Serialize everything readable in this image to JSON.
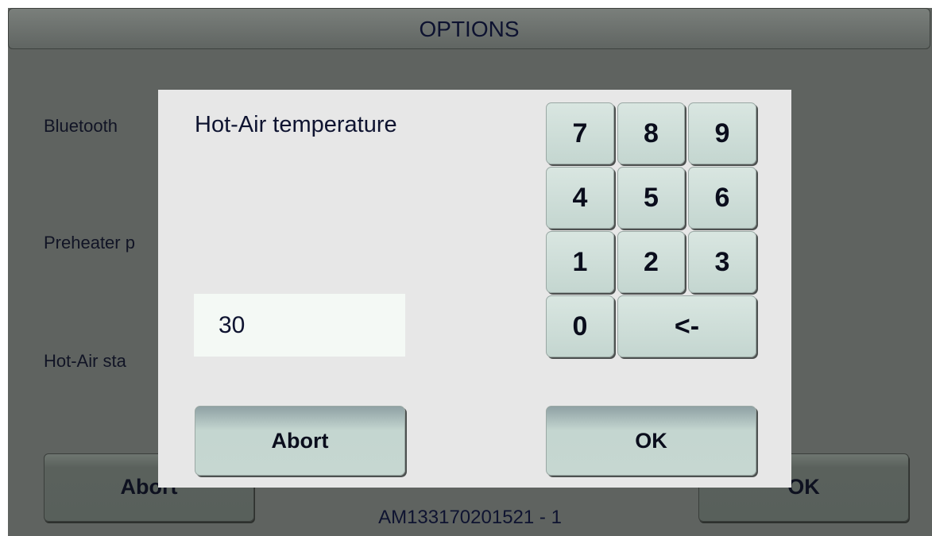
{
  "screen": {
    "title": "OPTIONS",
    "labels": [
      "Bluetooth",
      "Preheater p",
      "Hot-Air sta"
    ],
    "abort_label": "Abort",
    "ok_label": "OK",
    "serial": "AM133170201521 - 1"
  },
  "dialog": {
    "title": "Hot-Air temperature",
    "value": "30",
    "keys": {
      "k7": "7",
      "k8": "8",
      "k9": "9",
      "k4": "4",
      "k5": "5",
      "k6": "6",
      "k1": "1",
      "k2": "2",
      "k3": "3",
      "k0": "0",
      "backspace": "<-"
    },
    "abort_label": "Abort",
    "ok_label": "OK"
  }
}
